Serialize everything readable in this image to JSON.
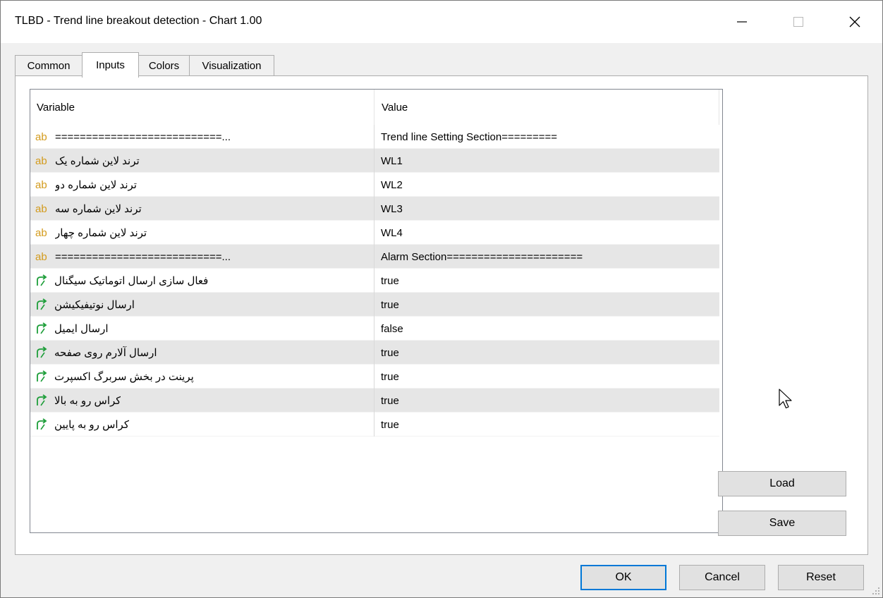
{
  "window": {
    "title": "TLBD - Trend line breakout detection - Chart 1.00",
    "minimize_icon": "minimize-icon",
    "maximize_icon": "maximize-icon",
    "close_icon": "close-icon"
  },
  "tabs": [
    {
      "label": "Common",
      "active": false
    },
    {
      "label": "Inputs",
      "active": true
    },
    {
      "label": "Colors",
      "active": false
    },
    {
      "label": "Visualization",
      "active": false
    }
  ],
  "grid": {
    "columns": [
      "Variable",
      "Value"
    ],
    "rows": [
      {
        "type": "ab",
        "variable": "===========================...",
        "value": "Trend line  Setting Section========="
      },
      {
        "type": "ab",
        "variable": "ترند لاین شماره یک",
        "value": "WL1"
      },
      {
        "type": "ab",
        "variable": "ترند لاین شماره دو",
        "value": "WL2"
      },
      {
        "type": "ab",
        "variable": "ترند لاین شماره سه",
        "value": "WL3"
      },
      {
        "type": "ab",
        "variable": "ترند لاین شماره چهار",
        "value": "WL4"
      },
      {
        "type": "ab",
        "variable": "===========================...",
        "value": "Alarm Section======================"
      },
      {
        "type": "bool",
        "variable": "فعال سازی ارسال اتوماتیک سیگنال",
        "value": "true"
      },
      {
        "type": "bool",
        "variable": "ارسال نوتیفیکیشن",
        "value": "true"
      },
      {
        "type": "bool",
        "variable": "ارسال ایمیل",
        "value": "false"
      },
      {
        "type": "bool",
        "variable": "ارسال آلارم روی صفحه",
        "value": "true"
      },
      {
        "type": "bool",
        "variable": "پرینت در بخش سربرگ اکسپرت",
        "value": "true"
      },
      {
        "type": "bool",
        "variable": "کراس رو به بالا",
        "value": "true"
      },
      {
        "type": "bool",
        "variable": "کراس رو به پایین",
        "value": "true"
      }
    ]
  },
  "side_buttons": {
    "load": "Load",
    "save": "Save"
  },
  "footer_buttons": {
    "ok": "OK",
    "cancel": "Cancel",
    "reset": "Reset"
  },
  "colors": {
    "string_icon": "#d39a1a",
    "bool_icon": "#1e9e3a",
    "ok_border": "#0078d7"
  }
}
